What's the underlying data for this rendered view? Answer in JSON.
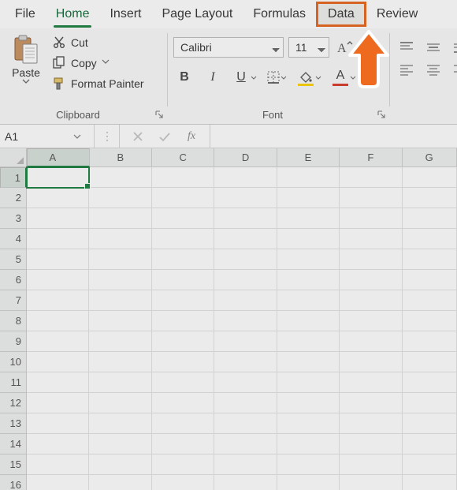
{
  "tabs": {
    "file": "File",
    "home": "Home",
    "insert": "Insert",
    "pagelayout": "Page Layout",
    "formulas": "Formulas",
    "data": "Data",
    "review": "Review"
  },
  "clipboard": {
    "paste_label": "Paste",
    "cut_label": "Cut",
    "copy_label": "Copy",
    "formatpainter_label": "Format Painter",
    "group_label": "Clipboard"
  },
  "font": {
    "name_value": "Calibri",
    "size_value": "11",
    "bold_glyph": "B",
    "italic_glyph": "I",
    "underline_glyph": "U",
    "fontcolor_glyph": "A",
    "group_label": "Font"
  },
  "namebox": {
    "value": "A1"
  },
  "formula": {
    "fx_label": "fx",
    "value": ""
  },
  "columns": [
    "A",
    "B",
    "C",
    "D",
    "E",
    "F",
    "G"
  ],
  "rows": [
    "1",
    "2",
    "3",
    "4",
    "5",
    "6",
    "7",
    "8",
    "9",
    "10",
    "11",
    "12",
    "13",
    "14",
    "15",
    "16"
  ],
  "active_cell": {
    "row": 0,
    "col": 0
  }
}
